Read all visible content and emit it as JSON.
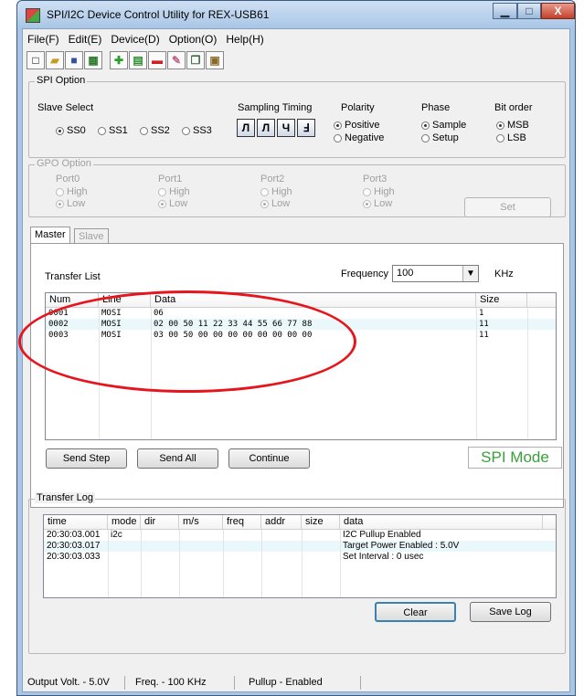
{
  "window": {
    "title": "SPI/I2C Device Control Utility for REX-USB61",
    "controls": {
      "minimize": "▁",
      "maximize": "□",
      "close": "X"
    }
  },
  "menu": [
    "File(F)",
    "Edit(E)",
    "Device(D)",
    "Option(O)",
    "Help(H)"
  ],
  "toolbar_icons": [
    "new-file-icon",
    "open-folder-icon",
    "save-icon",
    "device-icon",
    "add-icon",
    "grid-icon",
    "remove-icon",
    "eraser-icon",
    "copy-icon",
    "paste-icon"
  ],
  "spi_option": {
    "title": "SPI Option",
    "slave_select": {
      "label": "Slave Select",
      "options": [
        "SS0",
        "SS1",
        "SS2",
        "SS3"
      ],
      "selected": "SS0"
    },
    "sampling_timing": {
      "label": "Sampling Timing",
      "glyphs": [
        "Л",
        "Л",
        "Ч",
        "Ⅎ"
      ]
    },
    "polarity": {
      "label": "Polarity",
      "options": [
        "Positive",
        "Negative"
      ],
      "selected": "Positive"
    },
    "phase": {
      "label": "Phase",
      "options": [
        "Sample",
        "Setup"
      ],
      "selected": "Sample"
    },
    "bit_order": {
      "label": "Bit order",
      "options": [
        "MSB",
        "LSB"
      ],
      "selected": "MSB"
    }
  },
  "gpo_option": {
    "title": "GPO Option",
    "ports": [
      {
        "name": "Port0",
        "high": "High",
        "low": "Low"
      },
      {
        "name": "Port1",
        "high": "High",
        "low": "Low"
      },
      {
        "name": "Port2",
        "high": "High",
        "low": "Low"
      },
      {
        "name": "Port3",
        "high": "High",
        "low": "Low"
      }
    ],
    "set_label": "Set"
  },
  "tabs": {
    "master": "Master",
    "slave": "Slave"
  },
  "transfer": {
    "list_label": "Transfer List",
    "frequency_label": "Frequency",
    "frequency_value": "100",
    "frequency_unit": "KHz",
    "columns": [
      "Num",
      "Line",
      "Data",
      "Size"
    ],
    "rows": [
      {
        "num": "0001",
        "line": "MOSI",
        "data": "06",
        "size": "1"
      },
      {
        "num": "0002",
        "line": "MOSI",
        "data": "02 00 50 11 22 33 44 55 66 77 88",
        "size": "11"
      },
      {
        "num": "0003",
        "line": "MOSI",
        "data": "03 00 50 00 00 00 00 00 00 00 00",
        "size": "11"
      }
    ],
    "buttons": {
      "send_step": "Send Step",
      "send_all": "Send All",
      "continue": "Continue"
    },
    "mode": "SPI Mode"
  },
  "log": {
    "title": "Transfer Log",
    "columns": [
      "time",
      "mode",
      "dir",
      "m/s",
      "freq",
      "addr",
      "size",
      "data"
    ],
    "rows": [
      {
        "time": "20:30:03.001",
        "mode": "i2c",
        "data": "I2C Pullup Enabled"
      },
      {
        "time": "20:30:03.017",
        "mode": "",
        "data": "Target Power Enabled : 5.0V"
      },
      {
        "time": "20:30:03.033",
        "mode": "",
        "data": "Set Interval : 0 usec"
      }
    ],
    "clear": "Clear",
    "save": "Save Log"
  },
  "status": {
    "volt": "Output Volt. - 5.0V",
    "freq": "Freq. - 100 KHz",
    "pullup": "Pullup - Enabled"
  },
  "colors": {
    "annotation": "#e8141c",
    "spi_mode_text": "#3aa03a",
    "alt_row": "#eaf8fb"
  }
}
